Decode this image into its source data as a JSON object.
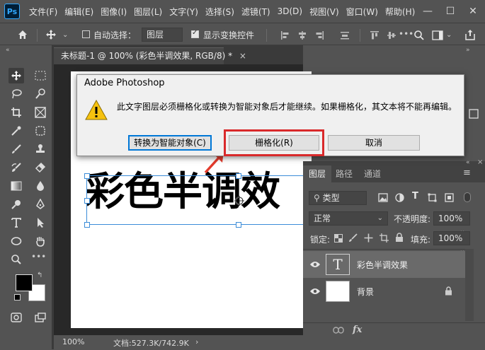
{
  "app": {
    "logo_text": "Ps"
  },
  "menus": [
    "文件(F)",
    "编辑(E)",
    "图像(I)",
    "图层(L)",
    "文字(Y)",
    "选择(S)",
    "滤镜(T)",
    "3D(D)",
    "视图(V)",
    "窗口(W)",
    "帮助(H)"
  ],
  "window_controls": {
    "minimize": "—",
    "maximize": "☐",
    "close": "✕"
  },
  "options_bar": {
    "auto_select_label": "自动选择：",
    "auto_select_checked": false,
    "auto_select_target": "图层",
    "show_transform_label": "显示变换控件",
    "show_transform_checked": true,
    "more": "•••"
  },
  "document": {
    "tab_title": "未标题-1 @ 100% (彩色半调效果, RGB/8) *",
    "tab_close": "×",
    "canvas_text": "彩色半调效",
    "zoom": "100%",
    "doc_info": "文档:527.3K/742.9K",
    "status_arrow": "›"
  },
  "dialog": {
    "title": "Adobe Photoshop",
    "message": "此文字图层必须栅格化或转换为智能对象后才能继续。如果栅格化，其文本将不能再编辑。",
    "buttons": {
      "smart_object": "转换为智能对象(C)",
      "rasterize": "栅格化(R)",
      "cancel": "取消"
    },
    "highlight_color": "#d9292b"
  },
  "layers_panel": {
    "tabs": [
      "图层",
      "路径",
      "通道"
    ],
    "active_tab": "图层",
    "filter_kind": "类型",
    "blend_mode": "正常",
    "opacity_label": "不透明度:",
    "opacity_value": "100%",
    "lock_label": "锁定:",
    "fill_label": "填充:",
    "fill_value": "100%",
    "layers": [
      {
        "name": "彩色半调效果",
        "type": "text",
        "visible": true,
        "selected": true
      },
      {
        "name": "背景",
        "type": "background",
        "visible": true,
        "locked": true
      }
    ],
    "footer": {
      "link": "⊖⊖",
      "fx": "fx"
    }
  },
  "colors": {
    "foreground": "#000000",
    "background": "#ffffff"
  }
}
